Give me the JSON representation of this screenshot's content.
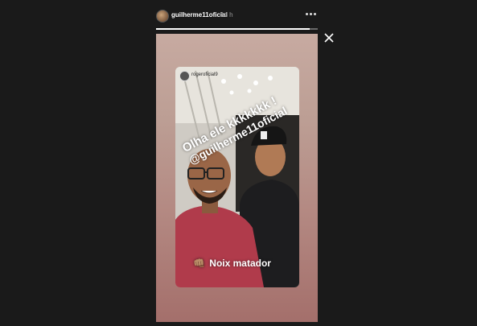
{
  "header": {
    "username": "guilherme11oficial",
    "time": "14 h",
    "progress": 0.95
  },
  "icons": {
    "more": "more-options-icon",
    "close": "close-icon"
  },
  "story": {
    "repost_username": "rogeroficial9",
    "caption_line1": "Olha ele kkkkkkk !",
    "caption_line2": "@guilherme11oficial",
    "sticker_emoji": "👊🏽",
    "sticker_text": "Noix matador"
  }
}
